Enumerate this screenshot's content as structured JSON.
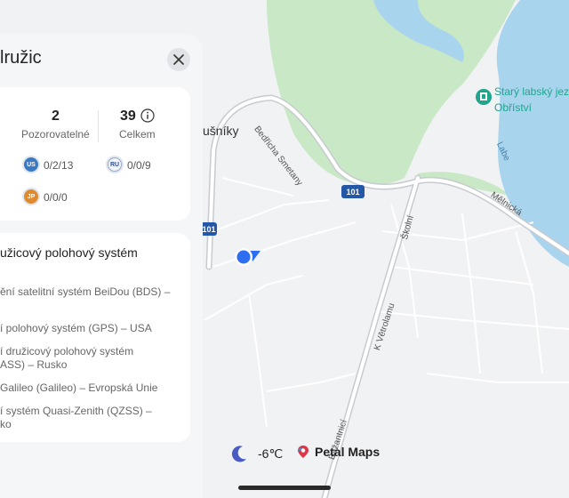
{
  "map": {
    "place_town": "ušníky",
    "road_bedricha": "Bedřicha Smetany",
    "road_skolni": "Školní",
    "road_vetrolamu": "K Větrolamu",
    "road_mielnicka": "Mělnická",
    "road_bazantnici": "Bažantnicí",
    "river_label": "Labe",
    "poi_name_line1": "Starý labský jez",
    "poi_name_line2": "Obříství",
    "road_shield_main": "101",
    "road_shield_left": "101"
  },
  "panel": {
    "title": "lružic",
    "stats": {
      "observable_value": "2",
      "observable_label": "Pozorovatelné",
      "total_value": "39",
      "total_label": "Celkem"
    },
    "constellations": [
      {
        "code": "US",
        "value": "0/2/13",
        "color": "#3b79c4"
      },
      {
        "code": "RU",
        "value": "0/0/9",
        "color": "#f2f4f8"
      },
      {
        "code": "JP",
        "value": "0/0/0",
        "color": "#e08a2e"
      }
    ],
    "systems_title": "užicový polohový systém",
    "systems": [
      "ění satelitní systém BeiDou (BDS) –",
      "í polohový systém (GPS) – USA",
      "í družicový polohový systém\nASS) – Rusko",
      "Galileo (Galileo) – Evropská Unie",
      "í systém Quasi-Zenith (QZSS) –\nko"
    ]
  },
  "status": {
    "temperature": "-6℃",
    "brand": "Petal Maps"
  }
}
